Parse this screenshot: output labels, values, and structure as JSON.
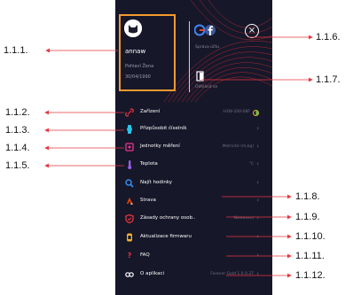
{
  "profile": {
    "username": "annaw",
    "gender": "Pohlaví  Žena",
    "dob": "30/04/1990"
  },
  "account": {
    "subtitle": "Správa účtu",
    "close_glyph": "×",
    "logout_label": "Odhlásit se"
  },
  "menu": [
    {
      "label": "Zařízení",
      "value": "H3W-200-08F",
      "icon": "link-icon",
      "color": "#e8363f"
    },
    {
      "label": "Přizpůsobit číselník",
      "value": "",
      "icon": "watch-face-icon",
      "color": "#27c3e8"
    },
    {
      "label": "Jednotky měření",
      "value": "Metrické (m,kg)",
      "icon": "units-icon",
      "color": "#e8368d"
    },
    {
      "label": "Teplota",
      "value": "℃",
      "icon": "thermometer-icon",
      "color": "#9b5de5"
    },
    {
      "label": "Najít hodinky",
      "value": "",
      "icon": "search-icon",
      "color": "#2f8ef0"
    },
    {
      "label": "Strava",
      "value": "",
      "icon": "strava-icon",
      "color": "#fc4c02"
    },
    {
      "label": "Zásady ochrany osob..",
      "value": "Nastavení",
      "icon": "shield-icon",
      "color": "#e8363f"
    },
    {
      "label": "Aktualizace firmwaru",
      "value": "",
      "icon": "firmware-icon",
      "color": "#f3b22e"
    },
    {
      "label": "FAQ",
      "value": "",
      "icon": "question-icon",
      "color": "#e8363f"
    },
    {
      "label": "O aplikaci",
      "value": "Forever Gold 1.0.0.37",
      "icon": "info-icon",
      "color": "#ffffff"
    }
  ],
  "chevron": "›",
  "callouts": {
    "c111": "1.1.1.",
    "c112": "1.1.2.",
    "c113": "1.1.3.",
    "c114": "1.1.4.",
    "c115": "1.1.5.",
    "c116": "1.1.6.",
    "c117": "1.1.7.",
    "c118": "1.1.8.",
    "c119": "1.1.9.",
    "c1110": "1.1.10.",
    "c1111": "1.1.11.",
    "c1112": "1.1.12."
  },
  "colors": {
    "panel": "#17172a",
    "accent": "#f39a2e",
    "wave": "#d8302f"
  }
}
